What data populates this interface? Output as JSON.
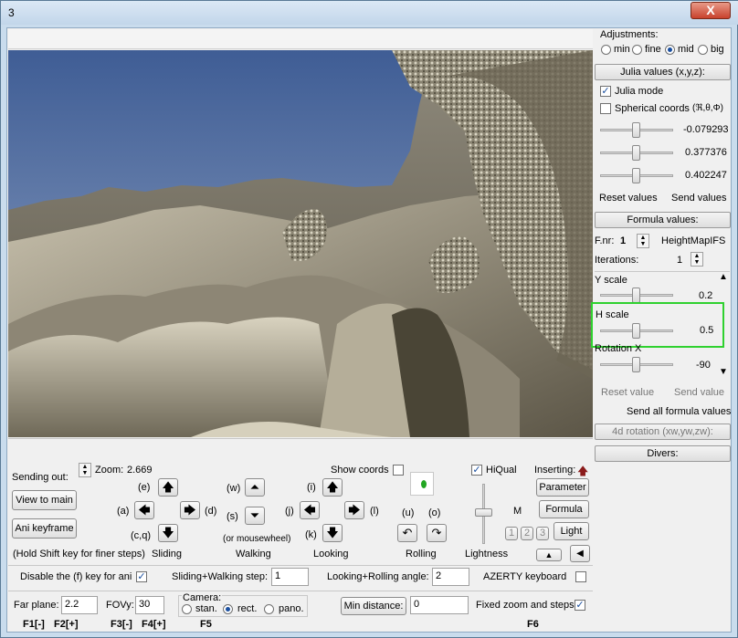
{
  "window": {
    "title": "3",
    "close": "X"
  },
  "viewport": {
    "alt": ""
  },
  "right": {
    "adjustments": {
      "label": "Adjustments:",
      "options": [
        "min",
        "fine",
        "mid",
        "big"
      ],
      "selected": "mid"
    },
    "julia_header": "Julia values (x,y,z):",
    "julia_mode": "Julia mode",
    "spherical": "Spherical coords",
    "spherical_sym": "(ℜ,θ,Φ)",
    "julia_vals": [
      "-0.079293",
      "0.377376",
      "0.402247"
    ],
    "reset_values": "Reset values",
    "send_values": "Send values",
    "formula_header": "Formula values:",
    "fnr_label": "F.nr:",
    "fnr": "1",
    "formula_name": "HeightMapIFS",
    "iter_label": "Iterations:",
    "iter": "1",
    "params": [
      {
        "name": "Y scale",
        "value": "0.2"
      },
      {
        "name": "H scale",
        "value": "0.5"
      },
      {
        "name": "Rotation X",
        "value": "-90"
      }
    ],
    "reset_value": "Reset value",
    "send_value": "Send value",
    "send_all": "Send all formula values",
    "rot4d": "4d rotation (xw,yw,zw):",
    "divers": "Divers:"
  },
  "nav": {
    "sending_out": "Sending out:",
    "view_to_main": "View to main",
    "ani_keyframe": "Ani keyframe",
    "hold_shift": "(Hold Shift key for finer steps)",
    "zoom_label": "Zoom:",
    "zoom": "2.669",
    "show_coords": "Show coords",
    "hiqual": "HiQual",
    "inserting": "Inserting:",
    "parameter": "Parameter",
    "formula": "Formula",
    "light": "Light",
    "m": "M",
    "lightness_nums": [
      "1",
      "2",
      "3"
    ],
    "keys": {
      "e": "(e)",
      "a": "(a)",
      "d": "(d)",
      "cq": "(c,q)",
      "w": "(w)",
      "s": "(s)",
      "i": "(i)",
      "j": "(j)",
      "l": "(l)",
      "k": "(k)",
      "u": "(u)",
      "o": "(o)"
    },
    "mousewheel": "(or mousewheel)",
    "groups": [
      "Sliding",
      "Walking",
      "Looking",
      "Rolling",
      "Lightness"
    ]
  },
  "bottom": {
    "disable_f": "Disable the (f) key for ani",
    "sliding_step_label": "Sliding+Walking step:",
    "sliding_step": "1",
    "looking_label": "Looking+Rolling angle:",
    "looking": "2",
    "azerty": "AZERTY keyboard",
    "far_label": "Far plane:",
    "far": "2.2",
    "fov_label": "FOVy:",
    "fov": "30",
    "camera_label": "Camera:",
    "camera_options": [
      "stan.",
      "rect.",
      "pano."
    ],
    "camera_selected": "rect.",
    "min_distance": "Min distance:",
    "min_distance_val": "0",
    "fixed_zoom": "Fixed zoom and steps",
    "fkeys": [
      "F1[-]",
      "F2[+]",
      "F3[-]",
      "F4[+]",
      "F5",
      "F6"
    ]
  },
  "colors": {
    "highlight": "#2fd12f",
    "sky_top": "#3f5d95",
    "sky_bottom": "#9fb2c9",
    "terrain": "#a29a86"
  }
}
